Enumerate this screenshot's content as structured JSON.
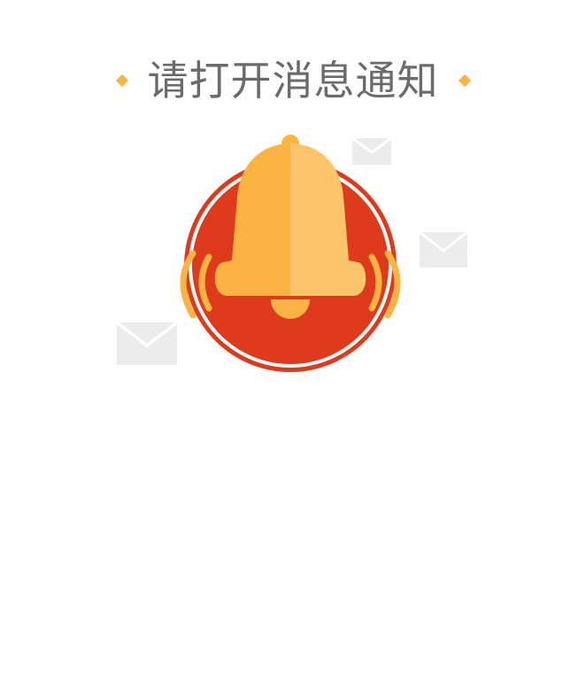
{
  "title": {
    "text": "请打开消息通知"
  },
  "colors": {
    "title_text": "#6b6b6b",
    "accent_diamond": "#fbb342",
    "circle_red": "#dd3b1b",
    "bell_main": "#fbb342",
    "bell_highlight": "#fdc56b",
    "envelope_gray": "#ececec"
  },
  "icons": {
    "bell": "bell-icon",
    "envelope": "envelope-icon",
    "sound_wave": "sound-wave-icon"
  }
}
